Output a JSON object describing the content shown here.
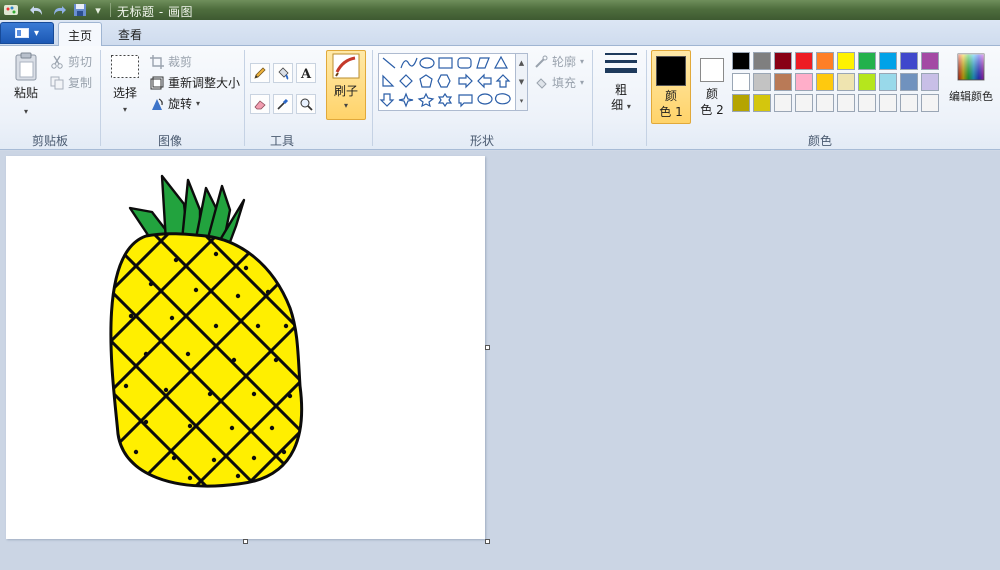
{
  "window": {
    "title": "无标题 - 画图"
  },
  "tabs": {
    "home": "主页",
    "view": "查看"
  },
  "clipboard": {
    "group": "剪贴板",
    "paste": "粘贴",
    "cut": "剪切",
    "copy": "复制"
  },
  "image": {
    "group": "图像",
    "select": "选择",
    "crop": "裁剪",
    "resize": "重新调整大小",
    "rotate": "旋转"
  },
  "tools": {
    "group": "工具"
  },
  "brushes": {
    "label": "刷子"
  },
  "shapes": {
    "group": "形状",
    "outline": "轮廓",
    "fill": "填充"
  },
  "size": {
    "line1": "粗",
    "line2": "细"
  },
  "colors": {
    "group": "颜色",
    "color1_line1": "颜",
    "color1_line2": "色 1",
    "color2_line1": "颜",
    "color2_line2": "色 2",
    "color1_value": "#000000",
    "color2_value": "#ffffff",
    "edit": "编辑颜色",
    "palette_row1": [
      "#000000",
      "#7f7f7f",
      "#880015",
      "#ed1c24",
      "#ff7f27",
      "#fff200",
      "#22b14c",
      "#00a2e8",
      "#3f48cc",
      "#a349a4"
    ],
    "palette_row2": [
      "#ffffff",
      "#c3c3c3",
      "#b97a57",
      "#ffaec9",
      "#ffc90e",
      "#efe4b0",
      "#b5e61d",
      "#99d9ea",
      "#7092be",
      "#c8bfe7"
    ],
    "palette_row3": [
      "#b5a400",
      "#d4c60d",
      "#f4f4f4",
      "#f4f4f4",
      "#f4f4f4",
      "#f4f4f4",
      "#f4f4f4",
      "#f4f4f4",
      "#f4f4f4",
      "#f4f4f4"
    ]
  },
  "drawing": {
    "subject": "pineapple",
    "body_color": "#ffef00",
    "leaf_color": "#22a33e"
  }
}
